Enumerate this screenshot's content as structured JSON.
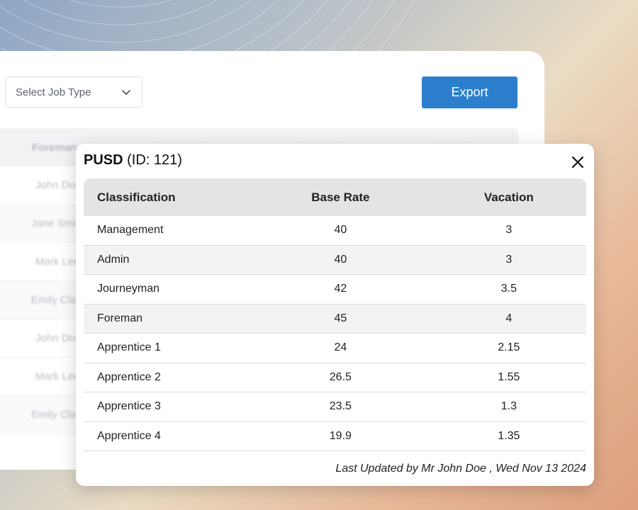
{
  "toolbar": {
    "select_placeholder": "Select Job Type",
    "export_label": "Export"
  },
  "background_table": {
    "headers": [
      "Foreman",
      "",
      "",
      ""
    ],
    "rows": [
      "John Doe",
      "Jane Smith",
      "Mark Lee",
      "Emily Clark",
      "John Doe",
      "Mark Lee",
      "Emily Clark"
    ]
  },
  "modal": {
    "title_bold": "PUSD",
    "title_rest": "(ID: 121)",
    "columns": [
      "Classification",
      "Base Rate",
      "Vacation"
    ],
    "rows": [
      [
        "Management",
        "40",
        "3"
      ],
      [
        "Admin",
        "40",
        "3"
      ],
      [
        "Journeyman",
        "42",
        "3.5"
      ],
      [
        "Foreman",
        "45",
        "4"
      ],
      [
        "Apprentice 1",
        "24",
        "2.15"
      ],
      [
        "Apprentice 2",
        "26.5",
        "1.55"
      ],
      [
        "Apprentice 3",
        "23.5",
        "1.3"
      ],
      [
        "Apprentice 4",
        "19.9",
        "1.35"
      ]
    ],
    "footer": "Last Updated by Mr John Doe , Wed Nov 13 2024"
  },
  "colors": {
    "accent": "#2c7fcc",
    "header_bg": "#e4e4e5",
    "alt_row": "#f3f3f4"
  },
  "icons": {
    "select_chevron": "chevron-down-icon",
    "close": "close-icon"
  }
}
